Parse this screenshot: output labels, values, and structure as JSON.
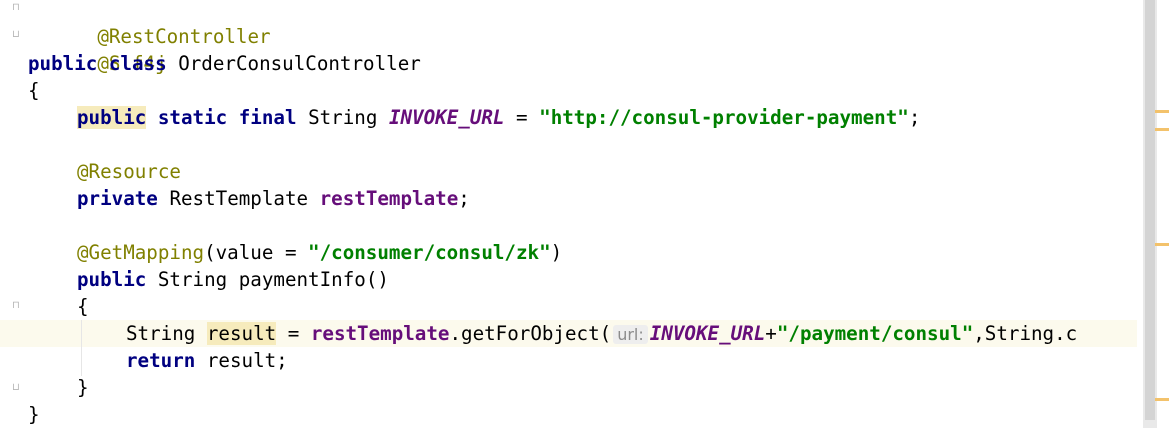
{
  "editor": {
    "lines": {
      "l1": {
        "annotation": "@RestController"
      },
      "l2": {
        "annotation": "@Slf4j"
      },
      "l3": {
        "kw_public": "public",
        "kw_class": "class",
        "class_name": "OrderConsulController"
      },
      "l4": {
        "brace": "{"
      },
      "l5": {
        "kw_public": "public",
        "kw_static": "static",
        "kw_final": "final",
        "type": "String",
        "const_name": "INVOKE_URL",
        "assign": " = ",
        "string": "\"http://consul-provider-payment\"",
        "end": ";"
      },
      "l7": {
        "annotation": "@Resource"
      },
      "l8": {
        "kw_private": "private",
        "type": "RestTemplate",
        "field": "restTemplate",
        "end": ";"
      },
      "l10": {
        "annotation": "@GetMapping",
        "open": "(value = ",
        "string": "\"/consumer/consul/zk\"",
        "close": ")"
      },
      "l11": {
        "kw_public": "public",
        "type": "String",
        "method": "paymentInfo()"
      },
      "l12": {
        "brace": "{"
      },
      "l13": {
        "type": "String",
        "var": "result",
        "assign": " = ",
        "field": "restTemplate",
        "call": ".getForObject(",
        "hint": "url:",
        "const_name": "INVOKE_URL",
        "plus": "+",
        "string": "\"/payment/consul\"",
        "rest": ",String.c"
      },
      "l14": {
        "kw_return": "return",
        "rest": " result;"
      },
      "l15": {
        "brace": "}"
      },
      "l16": {
        "brace": "}"
      }
    }
  },
  "colors": {
    "keyword": "#000080",
    "annotation": "#808000",
    "string": "#008000",
    "constant": "#660e7a",
    "current_line": "#fcfaed"
  }
}
